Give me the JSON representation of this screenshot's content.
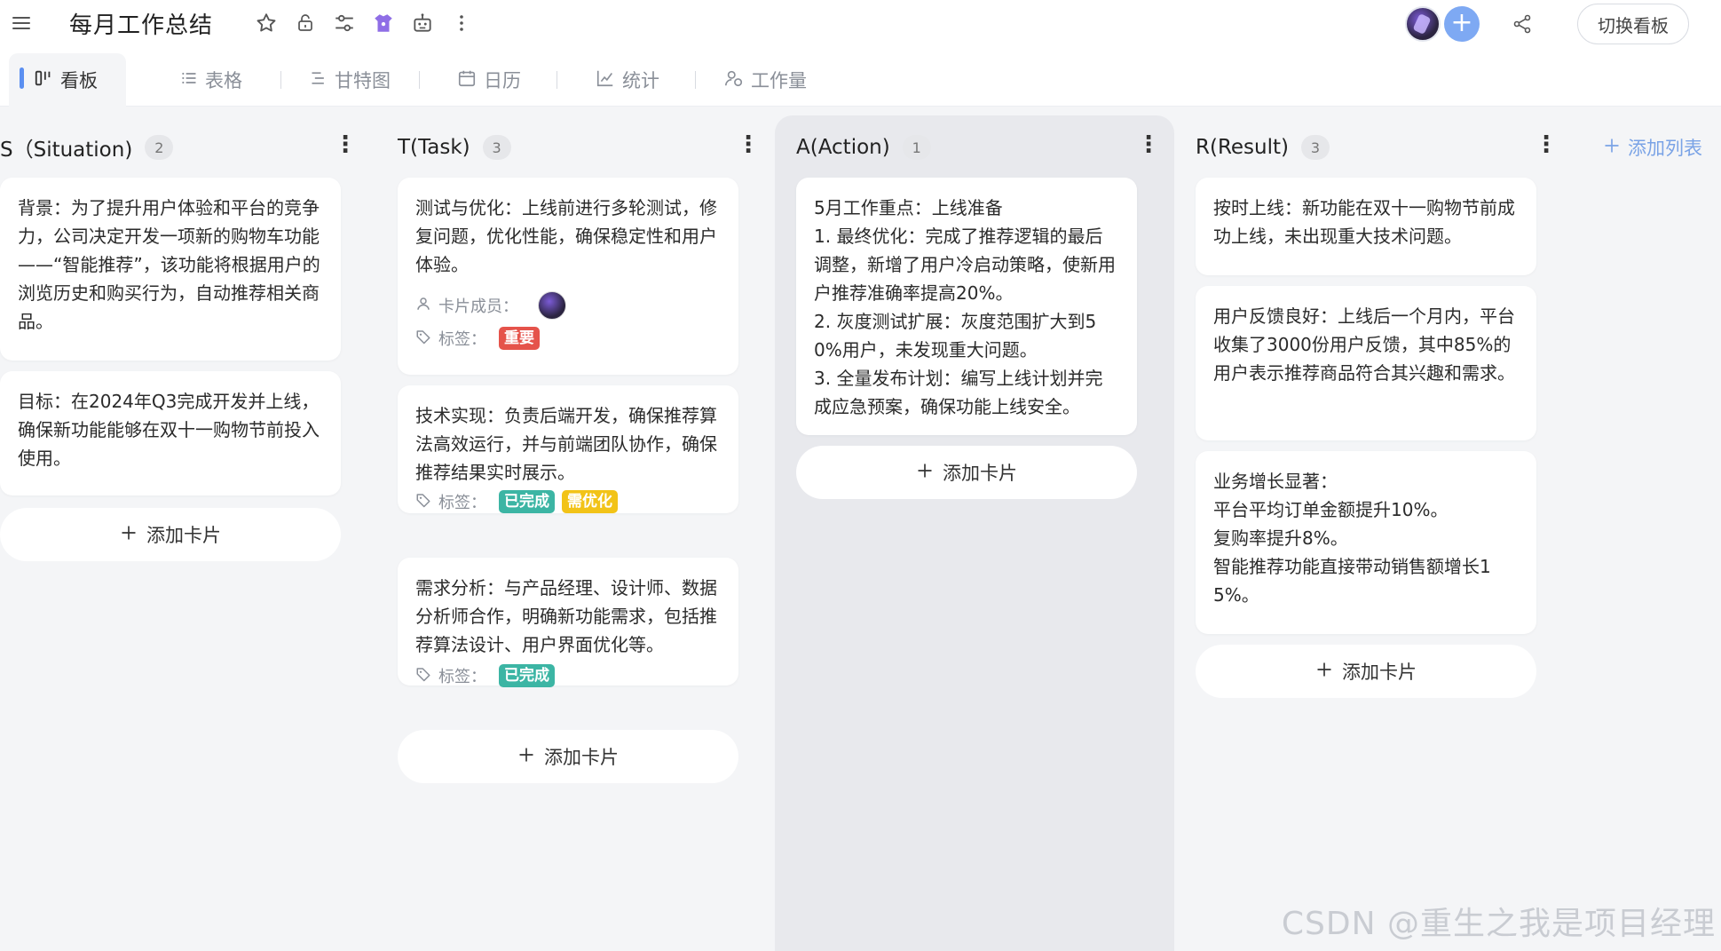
{
  "app": {
    "title": "每月工作总结",
    "switch_board_label": "切换看板"
  },
  "tabs": [
    {
      "label": "看板",
      "icon": "kanban-icon",
      "active": true
    },
    {
      "label": "表格",
      "icon": "list-icon",
      "active": false
    },
    {
      "label": "甘特图",
      "icon": "gantt-icon",
      "active": false
    },
    {
      "label": "日历",
      "icon": "calendar-icon",
      "active": false
    },
    {
      "label": "统计",
      "icon": "chart-icon",
      "active": false
    },
    {
      "label": "工作量",
      "icon": "workload-icon",
      "active": false
    }
  ],
  "columns": [
    {
      "title": "S（Situation)",
      "count": "2",
      "cards": [
        {
          "text": "背景：为了提升用户体验和平台的竞争力，公司决定开发一项新的购物车功能——“智能推荐”，该功能将根据用户的浏览历史和购买行为，自动推荐相关商品。"
        },
        {
          "text": "目标：在2024年Q3完成开发并上线，确保新功能能够在双十一购物节前投入使用。"
        }
      ],
      "add_card_label": "添加卡片"
    },
    {
      "title": "T(Task)",
      "count": "3",
      "cards": [
        {
          "text": "测试与优化：上线前进行多轮测试，修复问题，优化性能，确保稳定性和用户体验。",
          "members_label": "卡片成员：",
          "tags_label": "标签：",
          "tags": [
            "重要"
          ]
        },
        {
          "text": "技术实现：负责后端开发，确保推荐算法高效运行，并与前端团队协作，确保推荐结果实时展示。",
          "tags_label": "标签：",
          "tags": [
            "已完成",
            "需优化"
          ]
        },
        {
          "text": "需求分析：与产品经理、设计师、数据分析师合作，明确新功能需求，包括推荐算法设计、用户界面优化等。",
          "tags_label": "标签：",
          "tags": [
            "已完成"
          ]
        }
      ],
      "add_card_label": "添加卡片"
    },
    {
      "title": "A(Action)",
      "count": "1",
      "cards": [
        {
          "text": "5月工作重点：上线准备\n1. 最终优化：完成了推荐逻辑的最后调整，新增了用户冷启动策略，使新用户推荐准确率提高20%。\n2. 灰度测试扩展：灰度范围扩大到50%用户，未发现重大问题。\n3. 全量发布计划：编写上线计划并完成应急预案，确保功能上线安全。"
        }
      ],
      "add_card_label": "添加卡片"
    },
    {
      "title": "R(Result)",
      "count": "3",
      "cards": [
        {
          "text": "按时上线：新功能在双十一购物节前成功上线，未出现重大技术问题。"
        },
        {
          "text": "用户反馈良好：上线后一个月内，平台收集了3000份用户反馈，其中85%的用户表示推荐商品符合其兴趣和需求。"
        },
        {
          "text": "业务增长显著：\n平台平均订单金额提升10%。\n复购率提升8%。\n智能推荐功能直接带动销售额增长15%。"
        }
      ],
      "add_card_label": "添加卡片"
    }
  ],
  "add_list_label": "添加列表",
  "tag_colors": {
    "重要": "#e5534b",
    "已完成": "#3cb5a4",
    "需优化": "#f2c318"
  },
  "accent": "#5b8ff1",
  "watermark": "CSDN @重生之我是项目经理"
}
